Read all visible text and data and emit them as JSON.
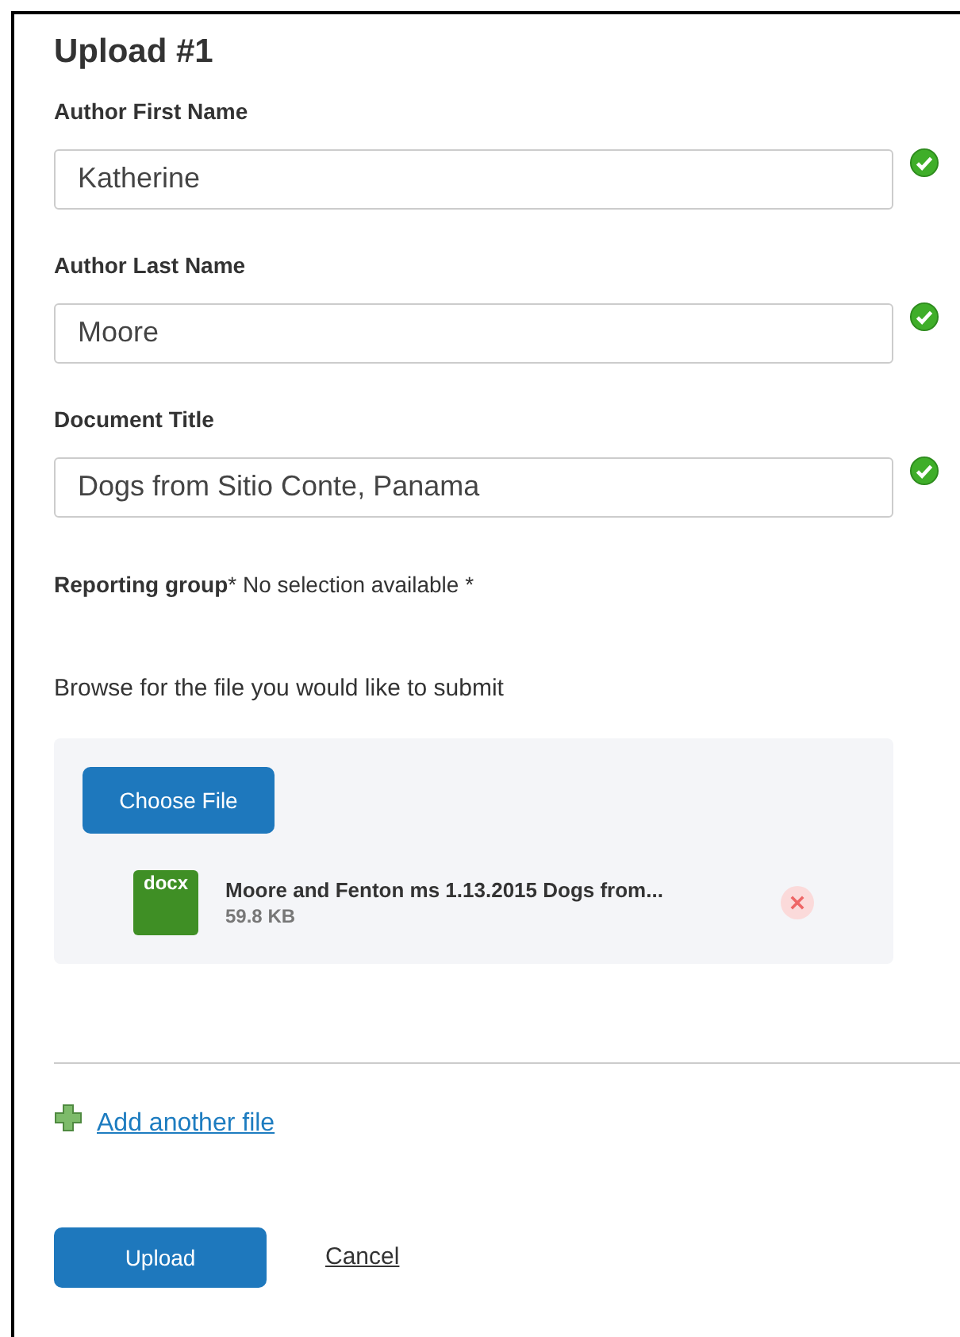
{
  "title": "Upload #1",
  "fields": [
    {
      "label": "Author First Name",
      "value": "Katherine",
      "valid": true
    },
    {
      "label": "Author Last Name",
      "value": "Moore",
      "valid": true
    },
    {
      "label": "Document Title",
      "value": "Dogs from Sitio Conte, Panama",
      "valid": true
    }
  ],
  "reporting_group": {
    "label": "Reporting group",
    "required_mark": "*",
    "value": "No selection available *"
  },
  "browse_prompt": "Browse for the file you would like to submit",
  "choose_file_button": "Choose File",
  "files": [
    {
      "type_badge": "docx",
      "name": "Moore and Fenton ms 1.13.2015 Dogs from...",
      "size": "59.8 KB"
    }
  ],
  "add_another_link": "Add another file",
  "buttons": {
    "upload": "Upload",
    "cancel": "Cancel"
  }
}
